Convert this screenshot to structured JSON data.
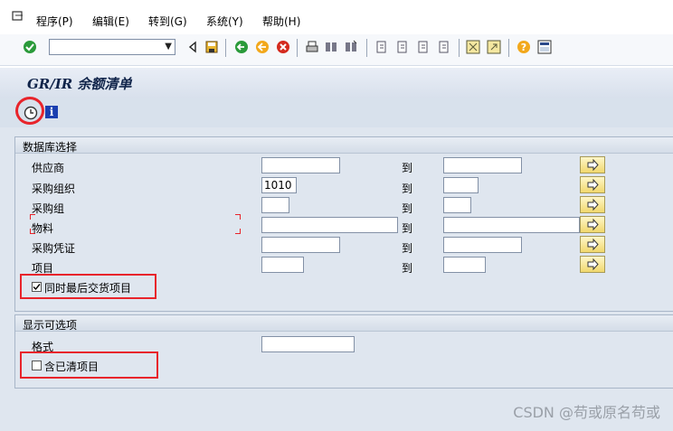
{
  "menubar": {
    "items": [
      "程序(P)",
      "编辑(E)",
      "转到(G)",
      "系统(Y)",
      "帮助(H)"
    ]
  },
  "toolbar": {
    "command_value": "",
    "icons": [
      "check-icon",
      "dropdown-icon",
      "back-triangle-icon",
      "save-icon",
      "back-icon",
      "exit-icon",
      "cancel-icon",
      "print-icon",
      "find-icon",
      "find-next-icon",
      "first-page-icon",
      "prev-page-icon",
      "next-page-icon",
      "last-page-icon",
      "new-session-icon",
      "shortcut-icon",
      "help-icon",
      "layout-icon"
    ]
  },
  "title": "GR/IR 余额清单",
  "app_toolbar": {
    "icons": [
      "execute-clock-icon",
      "info-icon"
    ]
  },
  "database_selection": {
    "title": "数据库选择",
    "to_label": "到",
    "rows": [
      {
        "label": "供应商",
        "from": "",
        "to": ""
      },
      {
        "label": "采购组织",
        "from": "1010",
        "to": ""
      },
      {
        "label": "采购组",
        "from": "",
        "to": ""
      },
      {
        "label": "物料",
        "from": "",
        "to": ""
      },
      {
        "label": "采购凭证",
        "from": "",
        "to": ""
      },
      {
        "label": "项目",
        "from": "",
        "to": ""
      }
    ],
    "checkbox": {
      "label": "同时最后交货项目",
      "checked": true
    }
  },
  "display_options": {
    "title": "显示可选项",
    "format_label": "格式",
    "format_value": "",
    "checkbox": {
      "label": "含已清项目",
      "checked": false
    }
  },
  "watermark": "CSDN @苟或原名苟或",
  "colors": {
    "highlight": "#e8242b",
    "arrow_button": "#f1d86e",
    "panel": "#dfe6ef"
  }
}
